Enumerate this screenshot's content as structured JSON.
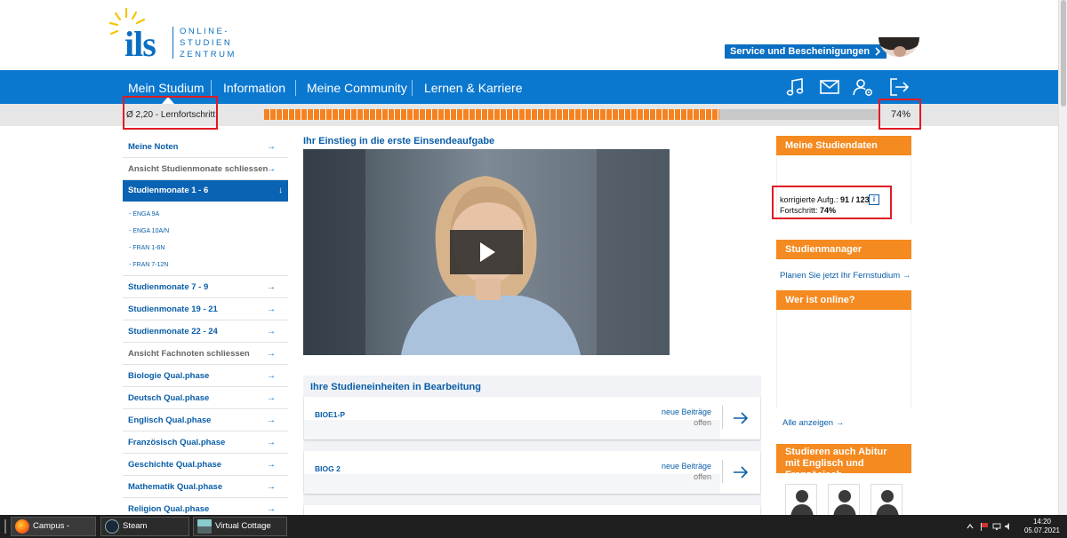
{
  "logo": {
    "brand": "ils",
    "tagline_1": "ONLINE-",
    "tagline_2": "STUDIEN",
    "tagline_3": "ZENTRUM"
  },
  "header": {
    "service_button": "Service und Bescheinigungen"
  },
  "nav": {
    "items": [
      {
        "label": "Mein Studium"
      },
      {
        "label": "Information"
      },
      {
        "label": "Meine Community"
      },
      {
        "label": "Lernen & Karriere"
      }
    ],
    "icons": [
      "music-icon",
      "mail-icon",
      "user-settings-icon",
      "logout-icon"
    ]
  },
  "progress": {
    "label": "Ø 2,20 - Lernfortschritt:",
    "percent_text": "74%",
    "fraction": 0.74
  },
  "sidebar": {
    "items_top": [
      {
        "label": "Meine Noten",
        "style": "normal"
      },
      {
        "label": "Ansicht Studienmonate schliessen",
        "style": "grey"
      }
    ],
    "active": {
      "label": "Studienmonate 1 - 6",
      "arrow": "↓"
    },
    "sub_items": [
      "- ENGA 9A",
      "- ENGA 10A/N",
      "- FRAN 1-6N",
      "- FRAN 7-12N"
    ],
    "items_bottom": [
      {
        "label": "Studienmonate 7 - 9",
        "style": "normal"
      },
      {
        "label": "Studienmonate 19 - 21",
        "style": "normal"
      },
      {
        "label": "Studienmonate 22 - 24",
        "style": "normal"
      },
      {
        "label": "Ansicht Fachnoten schliessen",
        "style": "grey"
      },
      {
        "label": "Biologie Qual.phase",
        "style": "normal"
      },
      {
        "label": "Deutsch Qual.phase",
        "style": "normal"
      },
      {
        "label": "Englisch Qual.phase",
        "style": "normal"
      },
      {
        "label": "Französisch Qual.phase",
        "style": "normal"
      },
      {
        "label": "Geschichte Qual.phase",
        "style": "normal"
      },
      {
        "label": "Mathematik Qual.phase",
        "style": "normal"
      },
      {
        "label": "Religion Qual.phase",
        "style": "normal"
      }
    ],
    "arrow": "→"
  },
  "main": {
    "video_title": "Ihr Einstieg in die erste Einsendeaufgabe",
    "units_title": "Ihre Studieneinheiten in Bearbeitung",
    "units": [
      {
        "name": "BIOE1-P",
        "new": "neue Beiträge",
        "open": "offen"
      },
      {
        "name": "BIOG 2",
        "new": "neue Beiträge",
        "open": "offen"
      }
    ]
  },
  "right": {
    "studdata_title": "Meine Studiendaten",
    "corrected_label": "korrigierte Aufg.:",
    "corrected_value": "91 / 123",
    "info_label": "i",
    "progress_label": "Fortschritt:",
    "progress_value": "74%",
    "studienmanager_title": "Studienmanager",
    "studienmanager_link": "Planen Sie jetzt Ihr Fernstudium",
    "online_title": "Wer ist online?",
    "all_link": "Alle anzeigen",
    "abitur_title": "Studieren auch Abitur mit Englisch und Französisch"
  },
  "taskbar": {
    "buttons": [
      {
        "label": "Campus - Mozilla..."
      },
      {
        "label": "Steam"
      },
      {
        "label": "Virtual Cottage"
      }
    ],
    "time": "14:20",
    "date": "05.07.2021"
  },
  "colors": {
    "brand_blue": "#0b78d0",
    "accent_orange": "#f58a20",
    "highlight_red": "#e01b22"
  }
}
